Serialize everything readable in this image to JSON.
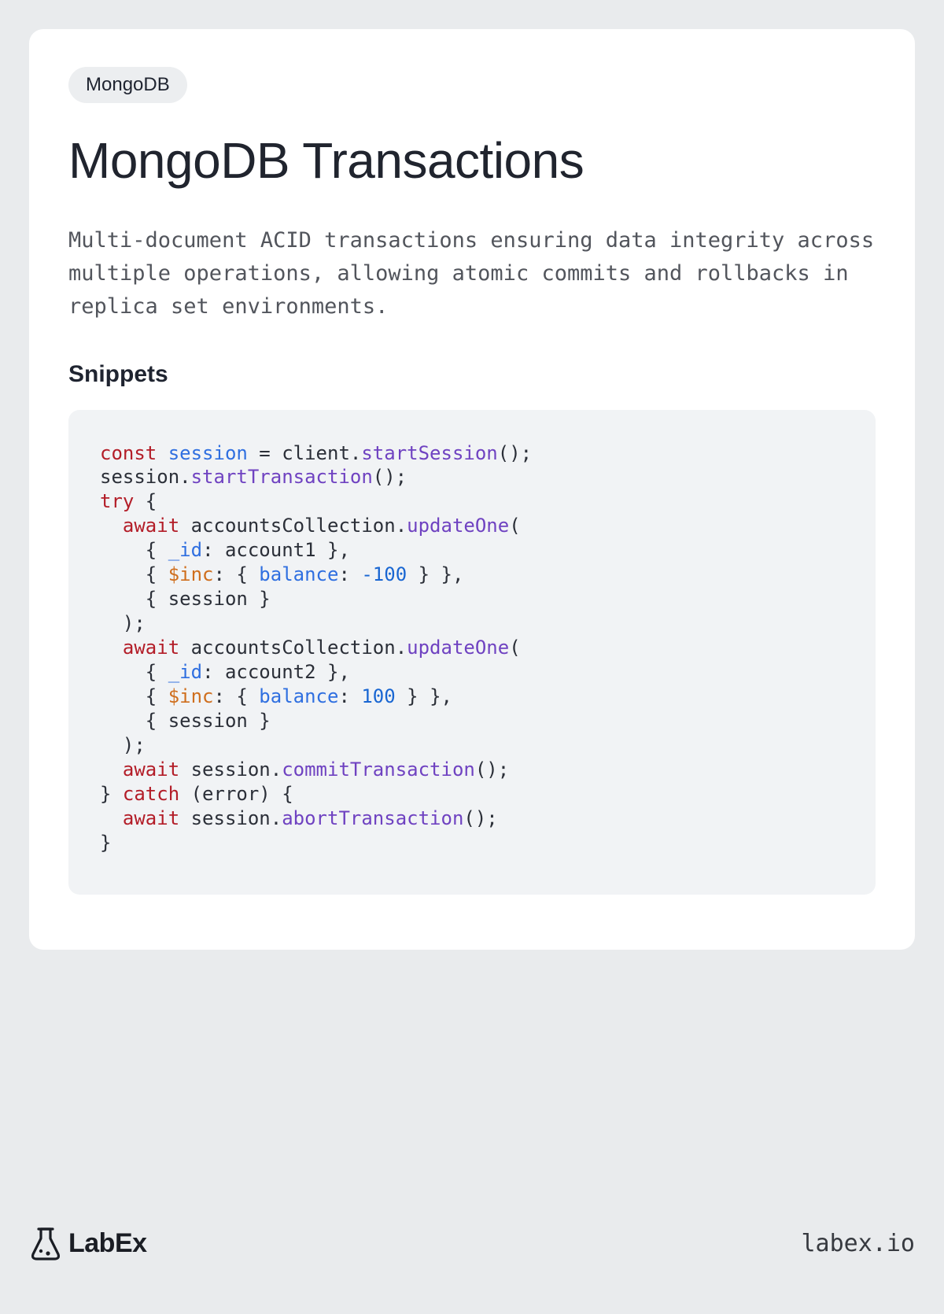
{
  "tag": "MongoDB",
  "title": "MongoDB Transactions",
  "description": "Multi-document ACID transactions ensuring data integrity across multiple operations, allowing atomic commits and rollbacks in replica set environments.",
  "snippets_heading": "Snippets",
  "code": {
    "lines": [
      [
        {
          "t": "const ",
          "c": "tok-kw"
        },
        {
          "t": "session",
          "c": "tok-var"
        },
        {
          "t": " = client."
        },
        {
          "t": "startSession",
          "c": "tok-fn"
        },
        {
          "t": "();"
        }
      ],
      [
        {
          "t": "session."
        },
        {
          "t": "startTransaction",
          "c": "tok-fn"
        },
        {
          "t": "();"
        }
      ],
      [
        {
          "t": "try",
          "c": "tok-kw"
        },
        {
          "t": " {"
        }
      ],
      [
        {
          "t": "  "
        },
        {
          "t": "await",
          "c": "tok-kw"
        },
        {
          "t": " accountsCollection."
        },
        {
          "t": "updateOne",
          "c": "tok-fn"
        },
        {
          "t": "("
        }
      ],
      [
        {
          "t": "    { "
        },
        {
          "t": "_id",
          "c": "tok-prop"
        },
        {
          "t": ": account1 },"
        }
      ],
      [
        {
          "t": "    { "
        },
        {
          "t": "$inc",
          "c": "tok-op"
        },
        {
          "t": ": { "
        },
        {
          "t": "balance",
          "c": "tok-prop"
        },
        {
          "t": ": "
        },
        {
          "t": "-100",
          "c": "tok-num"
        },
        {
          "t": " } },"
        }
      ],
      [
        {
          "t": "    { session }"
        }
      ],
      [
        {
          "t": "  );"
        }
      ],
      [
        {
          "t": "  "
        },
        {
          "t": "await",
          "c": "tok-kw"
        },
        {
          "t": " accountsCollection."
        },
        {
          "t": "updateOne",
          "c": "tok-fn"
        },
        {
          "t": "("
        }
      ],
      [
        {
          "t": "    { "
        },
        {
          "t": "_id",
          "c": "tok-prop"
        },
        {
          "t": ": account2 },"
        }
      ],
      [
        {
          "t": "    { "
        },
        {
          "t": "$inc",
          "c": "tok-op"
        },
        {
          "t": ": { "
        },
        {
          "t": "balance",
          "c": "tok-prop"
        },
        {
          "t": ": "
        },
        {
          "t": "100",
          "c": "tok-num"
        },
        {
          "t": " } },"
        }
      ],
      [
        {
          "t": "    { session }"
        }
      ],
      [
        {
          "t": "  );"
        }
      ],
      [
        {
          "t": "  "
        },
        {
          "t": "await",
          "c": "tok-kw"
        },
        {
          "t": " session."
        },
        {
          "t": "commitTransaction",
          "c": "tok-fn"
        },
        {
          "t": "();"
        }
      ],
      [
        {
          "t": "} "
        },
        {
          "t": "catch",
          "c": "tok-kw"
        },
        {
          "t": " (error) {"
        }
      ],
      [
        {
          "t": "  "
        },
        {
          "t": "await",
          "c": "tok-kw"
        },
        {
          "t": " session."
        },
        {
          "t": "abortTransaction",
          "c": "tok-fn"
        },
        {
          "t": "();"
        }
      ],
      [
        {
          "t": "}"
        }
      ]
    ]
  },
  "brand": "LabEx",
  "site": "labex.io"
}
